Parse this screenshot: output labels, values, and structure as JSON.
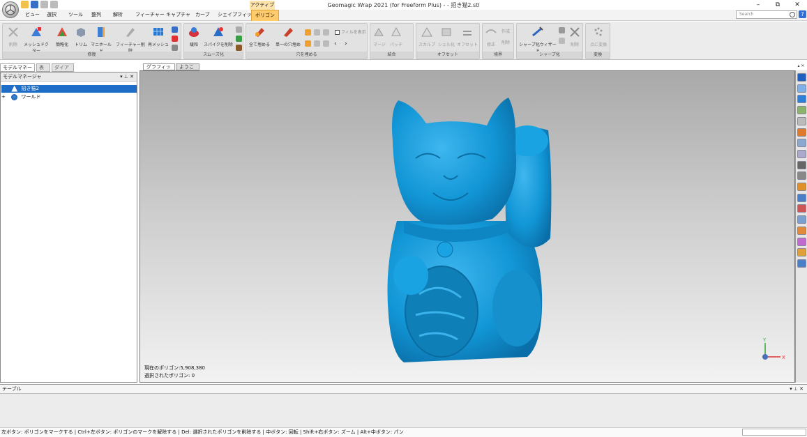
{
  "window": {
    "title": "Geomagic Wrap 2021 (for Freeform Plus) - - 招き猫2.stl",
    "context_tab": "アクティブ",
    "controls": [
      "–",
      "⧉",
      "✕"
    ]
  },
  "menu": {
    "items": [
      "ビュー",
      "選択",
      "ツール",
      "整列",
      "解析",
      "フィーチャー",
      "キャプチャ",
      "カーブ",
      "シェイプフィット",
      "ポリゴン"
    ],
    "active": "ポリゴン"
  },
  "search": {
    "placeholder": "Search"
  },
  "help": "?",
  "ribbon": {
    "groups": [
      {
        "label": "修復",
        "tools": [
          "削除",
          "メッシュドクター",
          "簡略化",
          "トリム",
          "マニホールド",
          "フィーチャー削除",
          "再メッシュ"
        ]
      },
      {
        "label": "スムーズ化",
        "tools": [
          "緩和",
          "スパイクを削除"
        ]
      },
      {
        "label": "穴を埋める",
        "tools": [
          "全て埋める",
          "単一の穴埋め"
        ],
        "checkbox": "フィルを表示"
      },
      {
        "label": "結合",
        "tools": [
          "マージ",
          "パッチ"
        ]
      },
      {
        "label": "オフセット",
        "tools": [
          "スカルプ",
          "シェル化",
          "オフセット"
        ]
      },
      {
        "label": "境界",
        "tools": [
          "修正",
          "作成",
          "削除"
        ]
      },
      {
        "label": "シャープ化",
        "tools": [
          "シャープ化ウィザード",
          "削除"
        ]
      },
      {
        "label": "変換",
        "tools": [
          "点に変換"
        ]
      }
    ]
  },
  "left_panel": {
    "tabs": [
      "モデルマネージャ",
      "表示",
      "ダイアログ"
    ],
    "header": "モデルマネージャ",
    "header_ctrls": "▾ ⊥ ✕",
    "tree": [
      {
        "label": "招き猫2",
        "selected": true,
        "expander": ""
      },
      {
        "label": "ワールド",
        "selected": false,
        "expander": "+"
      }
    ]
  },
  "viewport": {
    "tabs": [
      "グラフィックス",
      "ようこそ"
    ],
    "stats": {
      "polys": "現在のポリゴン:5,908,380",
      "selected": "選択されたポリゴン: 0"
    },
    "axis": {
      "y": "Y",
      "x": "X"
    },
    "model_color": "#1296d6"
  },
  "right_toolbar": {
    "top_ctrls": "▴ ✕"
  },
  "bottom_panel": {
    "header": "テーブル",
    "ctrls": "▾ ⊥ ✕"
  },
  "status": {
    "text": "左ボタン: ポリゴンをマークする | Ctrl+左ボタン: ポリゴンのマークを解除する | Del: 選択されたポリゴンを削除する | 中ボタン: 回転 | Shift+右ボタン: ズーム | Alt+中ボタン: パン",
    "progress": 0.0
  }
}
